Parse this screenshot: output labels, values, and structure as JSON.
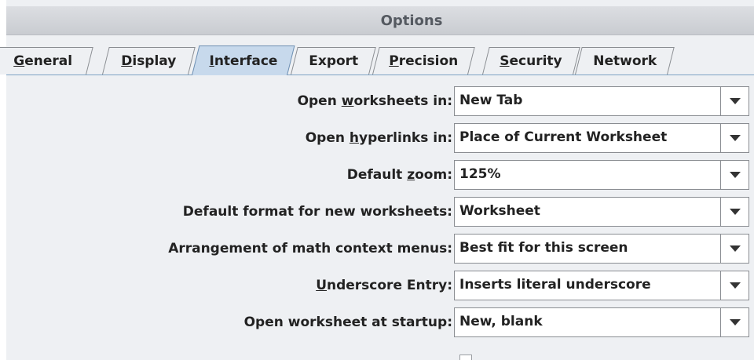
{
  "window": {
    "title": "Options"
  },
  "tabs": [
    {
      "label_prefix": "",
      "label_mnemonic": "G",
      "label_suffix": "eneral",
      "selected": false
    },
    {
      "label_prefix": "",
      "label_mnemonic": "D",
      "label_suffix": "isplay",
      "selected": false
    },
    {
      "label_prefix": "",
      "label_mnemonic": "I",
      "label_suffix": "nterface",
      "selected": true
    },
    {
      "label_prefix": "",
      "label_mnemonic": "",
      "label_suffix": "Export",
      "selected": false
    },
    {
      "label_prefix": "",
      "label_mnemonic": "P",
      "label_suffix": "recision",
      "selected": false
    },
    {
      "label_prefix": "",
      "label_mnemonic": "S",
      "label_suffix": "ecurity",
      "selected": false
    },
    {
      "label_prefix": "",
      "label_mnemonic": "",
      "label_suffix": "Network",
      "selected": false
    }
  ],
  "settings": [
    {
      "label_prefix": "Open ",
      "label_mnemonic": "w",
      "label_suffix": "orksheets in:",
      "value": "New Tab"
    },
    {
      "label_prefix": "Open ",
      "label_mnemonic": "h",
      "label_suffix": "yperlinks in:",
      "value": "Place of Current Worksheet"
    },
    {
      "label_prefix": "Default ",
      "label_mnemonic": "z",
      "label_suffix": "oom:",
      "value": "125%"
    },
    {
      "label_prefix": "Default format for new worksheets:",
      "label_mnemonic": "",
      "label_suffix": "",
      "value": "Worksheet"
    },
    {
      "label_prefix": "Arrangement of math context menus:",
      "label_mnemonic": "",
      "label_suffix": "",
      "value": "Best fit for this screen"
    },
    {
      "label_prefix": "",
      "label_mnemonic": "U",
      "label_suffix": "nderscore Entry:",
      "value": "Inserts literal underscore"
    },
    {
      "label_prefix": "Open worksheet at startup:",
      "label_mnemonic": "",
      "label_suffix": "",
      "value": "New, blank"
    }
  ],
  "icons": {
    "dropdown": "chevron-down-icon"
  },
  "colors": {
    "selected_tab": "#c7d9ec",
    "tab_line": "#7da2c4",
    "background": "#eef0f3"
  }
}
